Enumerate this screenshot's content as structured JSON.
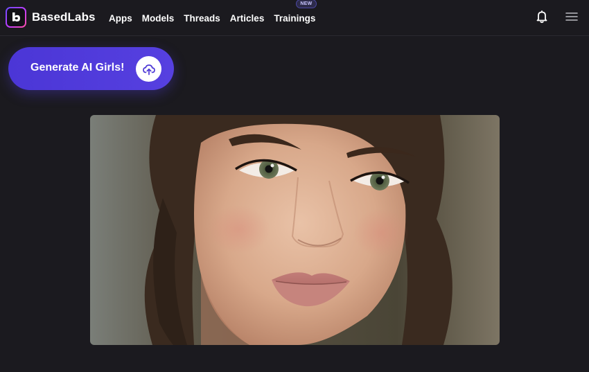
{
  "header": {
    "brand": "BasedLabs",
    "nav": [
      {
        "label": "Apps"
      },
      {
        "label": "Models"
      },
      {
        "label": "Threads"
      },
      {
        "label": "Articles"
      },
      {
        "label": "Trainings",
        "badge": "NEW"
      }
    ],
    "icons": {
      "notifications": "bell-icon",
      "menu": "hamburger-menu-icon"
    }
  },
  "cta": {
    "label": "Generate AI Girls!",
    "icon": "upload-cloud-icon",
    "color": "#4b36d6"
  },
  "hero_image": {
    "description_icon": "portrait-photo"
  },
  "colors": {
    "background": "#1b1a1f",
    "accent": "#4b36d6"
  }
}
